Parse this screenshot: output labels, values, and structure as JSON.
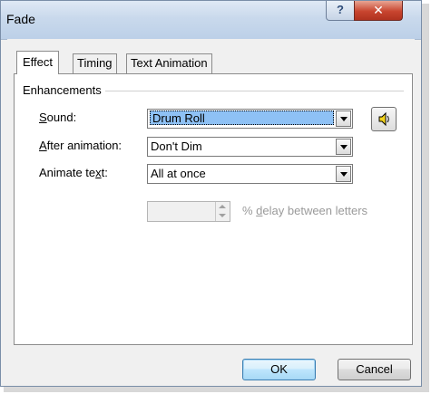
{
  "window": {
    "title": "Fade",
    "help_glyph": "?",
    "close_glyph": "✕"
  },
  "tabs": [
    {
      "label": "Effect",
      "active": true
    },
    {
      "label": "Timing",
      "active": false
    },
    {
      "label": "Text Animation",
      "active": false
    }
  ],
  "enhancements": {
    "group_label": "Enhancements",
    "sound": {
      "label_pre": "",
      "label_key": "S",
      "label_post": "ound:",
      "value": "Drum Roll"
    },
    "after_animation": {
      "label_pre": "",
      "label_key": "A",
      "label_post": "fter animation:",
      "value": "Don't Dim"
    },
    "animate_text": {
      "label_pre": "Animate te",
      "label_key": "x",
      "label_post": "t:",
      "value": "All at once"
    },
    "delay": {
      "value": "",
      "label_pre": "% ",
      "label_key": "d",
      "label_post": "elay between letters"
    }
  },
  "buttons": {
    "ok": "OK",
    "cancel": "Cancel"
  }
}
